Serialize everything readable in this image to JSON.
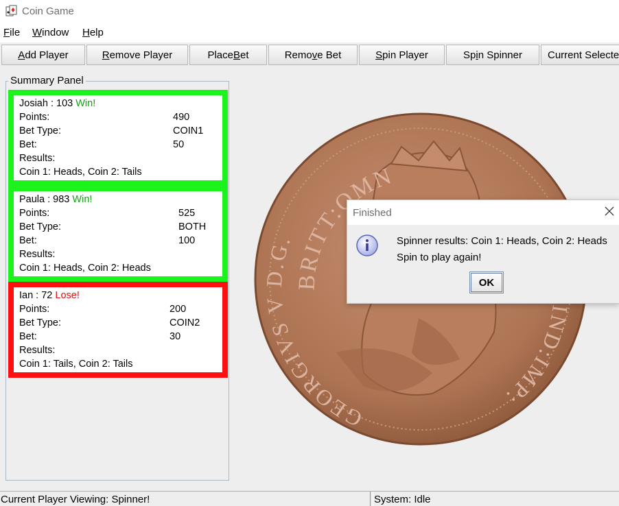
{
  "window": {
    "title": "Coin Game",
    "icon": "card-game-icon"
  },
  "menu": [
    {
      "label": "File",
      "mnemonic": "F"
    },
    {
      "label": "Window",
      "mnemonic": "W"
    },
    {
      "label": "Help",
      "mnemonic": "H"
    }
  ],
  "toolbar": {
    "buttons": [
      {
        "label": "Add Player",
        "mnemonic_index": 0
      },
      {
        "label": "Remove Player",
        "mnemonic_index": 0
      },
      {
        "label": "Place Bet",
        "mnemonic_index": 6
      },
      {
        "label": "Remove Bet",
        "mnemonic_index": 4
      },
      {
        "label": "Spin Player",
        "mnemonic_index": 0
      },
      {
        "label": "Spin Spinner",
        "mnemonic_index": 2
      },
      {
        "label": "Current Selecte"
      }
    ]
  },
  "summary": {
    "title": "Summary Panel",
    "labels": {
      "points": "Points:",
      "bet_type": "Bet Type:",
      "bet": "Bet:",
      "results": "Results:"
    },
    "players": [
      {
        "name": "Josiah : 103",
        "outcome": "Win!",
        "points": "490",
        "bet_type": "COIN1",
        "bet": "50",
        "results": "Coin 1: Heads, Coin 2: Tails",
        "border_color": "#1cf21c"
      },
      {
        "name": "Paula : 983",
        "outcome": "Win!",
        "points": "525",
        "bet_type": "BOTH",
        "bet": "100",
        "results": "Coin 1: Heads, Coin 2: Heads",
        "border_color": "#1cf21c"
      },
      {
        "name": "Ian : 72",
        "outcome": "Lose!",
        "points": "200",
        "bet_type": "COIN2",
        "bet": "30",
        "results": "Coin 1: Tails, Coin 2: Tails",
        "border_color": "#ff1010"
      }
    ]
  },
  "coin": {
    "inscription_top": "BRITT:OMN",
    "inscription_left": "GEORGIVS V D.G.",
    "inscription_right": "IND:IMP:",
    "color": "#b57a5a"
  },
  "dialog": {
    "title": "Finished",
    "line1": "Spinner results: Coin 1: Heads, Coin 2: Heads",
    "line2": "Spin to play again!",
    "ok_label": "OK",
    "icon": "info-icon"
  },
  "status": {
    "left": "Current Player Viewing: Spinner!",
    "right": "System: Idle"
  }
}
